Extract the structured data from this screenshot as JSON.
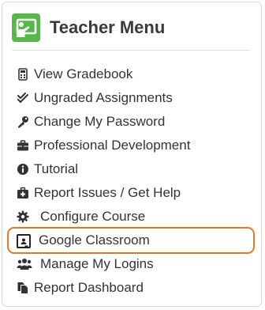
{
  "header": {
    "title": "Teacher Menu",
    "icon": "teacher-presentation-icon",
    "logo_color": "#56b84a"
  },
  "colors": {
    "text": "#333333",
    "highlight_border": "#e67a23"
  },
  "menu": {
    "items": [
      {
        "label": "View Gradebook",
        "icon": "calculator-icon"
      },
      {
        "label": "Ungraded Assignments",
        "icon": "double-check-icon"
      },
      {
        "label": "Change My Password",
        "icon": "key-icon"
      },
      {
        "label": "Professional Development",
        "icon": "briefcase-icon"
      },
      {
        "label": "Tutorial",
        "icon": "info-circle-icon"
      },
      {
        "label": "Report Issues / Get Help",
        "icon": "medkit-icon"
      },
      {
        "label": "Configure Course",
        "icon": "gear-icon"
      },
      {
        "label": "Google Classroom",
        "icon": "google-classroom-icon",
        "highlighted": true
      },
      {
        "label": "Manage My Logins",
        "icon": "users-icon"
      },
      {
        "label": "Report Dashboard",
        "icon": "copy-documents-icon"
      }
    ]
  }
}
